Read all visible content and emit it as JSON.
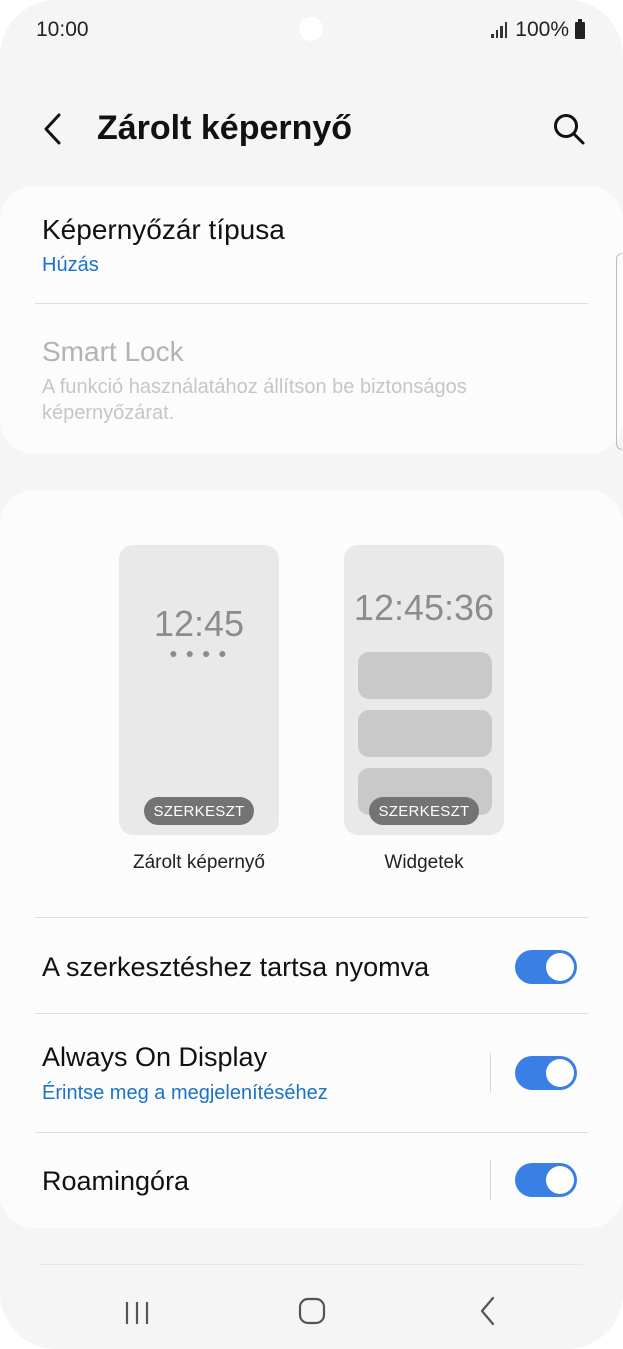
{
  "status_bar": {
    "time": "10:00",
    "battery": "100%"
  },
  "header": {
    "title": "Zárolt képernyő"
  },
  "lock_type": {
    "title": "Képernyőzár típusa",
    "value": "Húzás"
  },
  "smart_lock": {
    "title": "Smart Lock",
    "description": "A funkció használatához állítson be biztonságos képernyőzárat."
  },
  "previews": {
    "lock": {
      "clock": "12:45",
      "edit_label": "SZERKESZT",
      "caption": "Zárolt képernyő"
    },
    "widgets": {
      "clock": "12:45:36",
      "edit_label": "SZERKESZT",
      "caption": "Widgetek"
    }
  },
  "settings": {
    "hold_to_edit": {
      "label": "A szerkesztéshez tartsa nyomva",
      "enabled": true
    },
    "always_on_display": {
      "label": "Always On Display",
      "subtitle": "Érintse meg a megjelenítéséhez",
      "enabled": true
    },
    "roaming_clock": {
      "label": "Roamingóra",
      "enabled": true
    }
  },
  "colors": {
    "accent": "#3a7fe3",
    "link": "#1a73c9",
    "background": "#f5f5f5",
    "card": "#fcfcfc"
  }
}
